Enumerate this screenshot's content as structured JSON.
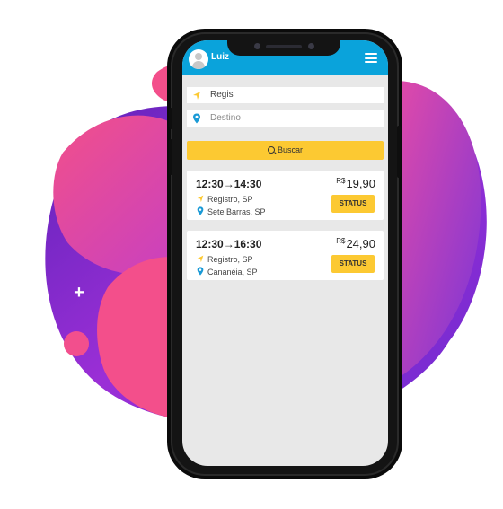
{
  "header": {
    "username": "Luiz",
    "avatar": "user-avatar-icon",
    "menu_icon": "hamburger-menu-icon",
    "color": "#0aa3db"
  },
  "search": {
    "origin_value": "Regis",
    "origin_icon": "navigation-arrow-icon",
    "destination_placeholder": "Destino",
    "destination_icon": "map-pin-icon",
    "button_label": "Buscar",
    "button_icon": "search-icon"
  },
  "trips": [
    {
      "departure": "12:30",
      "arrival": "14:30",
      "arrow": "→",
      "origin": "Registro, SP",
      "destination": "Sete Barras, SP",
      "currency": "R$",
      "price": "19,90",
      "status_label": "STATUS"
    },
    {
      "departure": "12:30",
      "arrival": "16:30",
      "arrow": "→",
      "origin": "Registro, SP",
      "destination": "Cananéia, SP",
      "currency": "R$",
      "price": "24,90",
      "status_label": "STATUS"
    }
  ],
  "colors": {
    "accent_yellow": "#fcc932",
    "pin_blue": "#1a9ad6",
    "blob_pink": "#f24f8d",
    "blob_purple": "#7a2ed1"
  }
}
